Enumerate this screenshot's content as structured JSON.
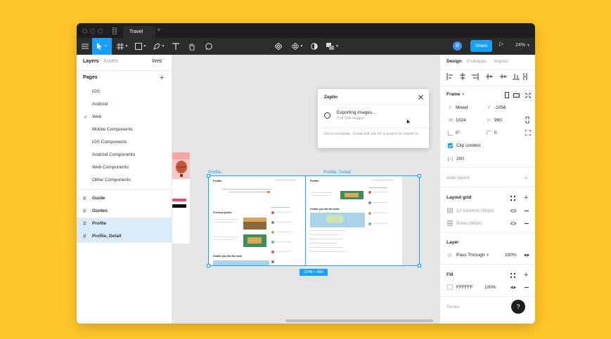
{
  "window": {
    "tab_title": "Travel",
    "tab_plus": "+"
  },
  "toolbar": {
    "user_initial": "B",
    "share_label": "Share",
    "zoom_level": "24%"
  },
  "left_panel": {
    "tabs": [
      "Layers",
      "Assets"
    ],
    "page_selector": "Web",
    "pages_title": "Pages",
    "pages": [
      "iOS",
      "Android",
      "Web",
      "Mobile Components",
      "iOS Components",
      "Android Components",
      "Web Components",
      "Other Components"
    ],
    "current_page": "Web",
    "layers": [
      {
        "label": "Guide",
        "selected": false
      },
      {
        "label": "Guides",
        "selected": false
      },
      {
        "label": "Profile",
        "selected": true
      },
      {
        "label": "Profile, Detail",
        "selected": true
      }
    ]
  },
  "canvas": {
    "frame_labels": [
      "Profile",
      "Profile, Detail"
    ],
    "selection_size": "2248 × 960",
    "frame_a": {
      "title": "Profile",
      "section1": "Previous points",
      "section2": "Guides you like the most"
    },
    "frame_b": {
      "title": "Profile",
      "section1": "Guides you like the most"
    }
  },
  "zeplin_dialog": {
    "title": "Zeplin",
    "status": "Exporting images...",
    "progress_text": "0 of 164 images",
    "note": "Once complete, Zeplin will ask for a project to export to."
  },
  "right_panel": {
    "tabs": [
      "Design",
      "Prototype",
      "Inspect"
    ],
    "frame_title": "Frame",
    "x_label": "X",
    "x_value": "Mixed",
    "y_label": "Y",
    "y_value": "-1056",
    "w_label": "W",
    "w_value": "1024",
    "h_label": "H",
    "h_value": "960",
    "rotation": "0°",
    "radius": "0",
    "clip_content": "Clip content",
    "clip_checked": true,
    "field_200": "200",
    "auto_layout": "Auto layout",
    "layout_grid": "Layout grid",
    "grid_columns": "12 columns (60px)",
    "grid_rows": "Rows (60px)",
    "layer_title": "Layer",
    "blend_mode": "Pass Through",
    "layer_opacity": "100%",
    "fill_title": "Fill",
    "fill_hex": "FFFFFF",
    "fill_opacity": "100%",
    "stroke_title": "Stroke",
    "help": "?"
  },
  "colors": {
    "accent": "#18A0FB",
    "background": "#FFC629",
    "toolbar": "#2c2c2c",
    "selection_bg": "#DAEBF7"
  }
}
